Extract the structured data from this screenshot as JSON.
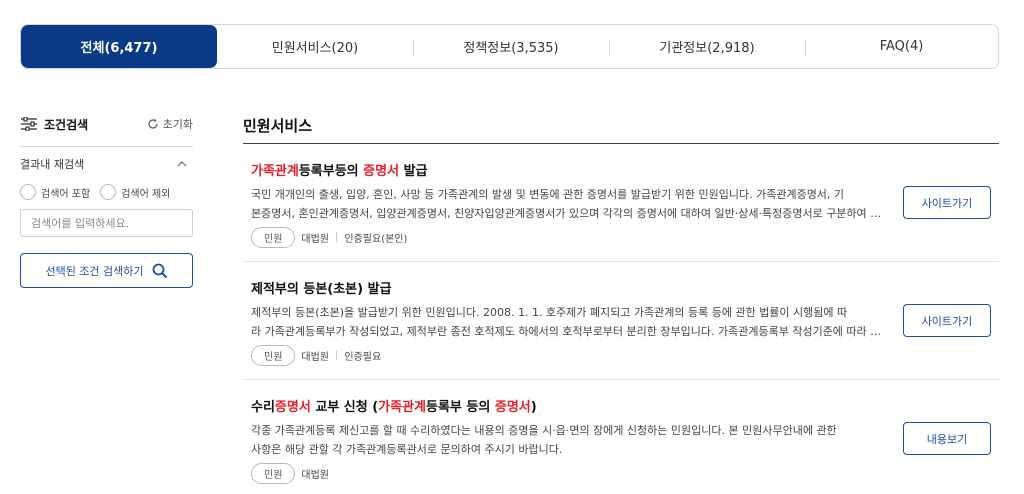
{
  "tabs": [
    {
      "label": "전체(6,477)",
      "active": true
    },
    {
      "label": "민원서비스(20)",
      "active": false
    },
    {
      "label": "정책정보(3,535)",
      "active": false
    },
    {
      "label": "기관정보(2,918)",
      "active": false
    },
    {
      "label": "FAQ(4)",
      "active": false
    }
  ],
  "sidebar": {
    "title": "조건검색",
    "title_icon": "sliders-icon",
    "reset_label": "초기화",
    "reset_icon": "refresh-icon",
    "refine_label": "결과내 재검색",
    "refine_icon": "chevron-up-icon",
    "include_label": "검색어 포함",
    "exclude_label": "검색어 제외",
    "input_placeholder": "검색어를 입력하세요.",
    "search_button_label": "선택된 조건 검색하기",
    "search_button_icon": "search-icon"
  },
  "main": {
    "section_title": "민원서비스",
    "items": [
      {
        "title_parts": [
          {
            "text": "가족관계",
            "hl": true
          },
          {
            "text": "등록부등의 ",
            "hl": false
          },
          {
            "text": "증명서",
            "hl": true
          },
          {
            "text": " 발급",
            "hl": false
          }
        ],
        "desc_line1": "국민 개개인의 출생, 입양, 혼인, 사망 등 가족관계의 발생 및 변동에 관한 증명서를 발급받기 위한 민원입니다. 가족관계증명서, 기",
        "desc_line2": "본증명서, 혼인관계증명서, 입양관계증명서, 친양자입양관계증명서가 있으며 각각의 증명서에 대하여 일반·상세·특정증명서로 구분하여 발급받을 수 있습니다.",
        "badge": "민원",
        "agency": "대법원",
        "auth": "인증필요(본인)",
        "button": "사이트가기"
      },
      {
        "title_parts": [
          {
            "text": "제적부의 등본(초본) 발급",
            "hl": false
          }
        ],
        "desc_line1": "제적부의 등본(초본)을 발급받기 위한 민원입니다. 2008. 1. 1. 호주제가 폐지되고 가족관계의 등록 등에 관한 법률이 시행됨에 따",
        "desc_line2": "라 가족관계등록부가 작성되었고, 제적부란 종전 호적제도 하에서의 호적부로부터 분리한 장부입니다. 가족관계등록부 작성기준에 따라 구분됩니다.",
        "badge": "민원",
        "agency": "대법원",
        "auth": "인증필요",
        "button": "사이트가기"
      },
      {
        "title_parts": [
          {
            "text": "수리",
            "hl": false
          },
          {
            "text": "증명서",
            "hl": true
          },
          {
            "text": " 교부 신청 (",
            "hl": false
          },
          {
            "text": "가족관계",
            "hl": true
          },
          {
            "text": "등록부 등의 ",
            "hl": false
          },
          {
            "text": "증명서",
            "hl": true
          },
          {
            "text": ")",
            "hl": false
          }
        ],
        "desc_line1": "각종 가족관계등록 제신고를 할 때 수리하였다는 내용의 증명을 시·읍·면의 장에게 신청하는 민원입니다. 본 민원사무안내에 관한",
        "desc_line2": "사항은 해당 관할 각 가족관계등록관서로 문의하여 주시기 바랍니다.",
        "badge": "민원",
        "agency": "대법원",
        "auth": "",
        "button": "내용보기"
      }
    ]
  }
}
